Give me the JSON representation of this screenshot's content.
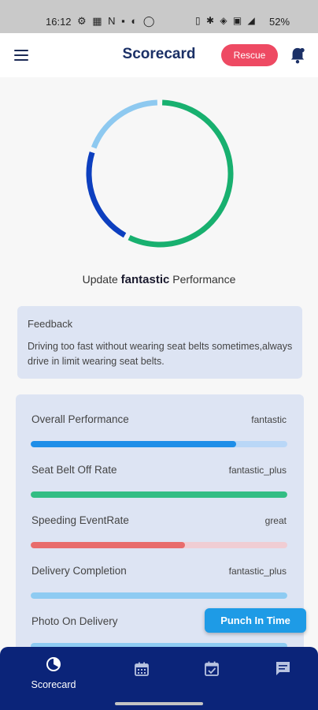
{
  "status_bar": {
    "time": "16:12",
    "left_icons": "⚙ ▦ N ▪ ◐ ◯",
    "right_icons": "▯ ✱ ◈ ▣ ◢",
    "battery": "52%"
  },
  "app_bar": {
    "title": "Scorecard",
    "rescue_label": "Rescue",
    "icons": [
      "hamburger-menu-icon",
      "bell-icon"
    ]
  },
  "donut": {
    "segments": [
      {
        "name": "green",
        "fraction": 0.55,
        "color": "#18b06f"
      },
      {
        "name": "dark-blue",
        "fraction": 0.21,
        "color": "#0d3fbf"
      },
      {
        "name": "light-blue",
        "fraction": 0.18,
        "color": "#8ec9f0"
      }
    ]
  },
  "update": {
    "prefix": "Update",
    "rating": "fantastic",
    "suffix": "Performance"
  },
  "feedback": {
    "title": "Feedback",
    "text": "Driving too fast without wearing seat belts sometimes,always drive in limit wearing seat belts."
  },
  "metrics": [
    {
      "label": "Overall Performance",
      "value": "fantastic",
      "progress": 0.8,
      "fill": "#1e8ee8",
      "track": "#b9d7f7"
    },
    {
      "label": "Seat Belt Off Rate",
      "value": "fantastic_plus",
      "progress": 1.0,
      "fill": "#33bd84",
      "track": "#bfe8d5"
    },
    {
      "label": "Speeding EventRate",
      "value": "great",
      "progress": 0.6,
      "fill": "#e86c6c",
      "track": "#f0cdd3"
    },
    {
      "label": "Delivery Completion",
      "value": "fantastic_plus",
      "progress": 1.0,
      "fill": "#8ecbf2",
      "track": "#cfe7f8"
    },
    {
      "label": "Photo On Delivery",
      "value": "",
      "progress": 1.0,
      "fill": "#8ecbf2",
      "track": "#cfe7f8"
    }
  ],
  "punch_button": "Punch In Time",
  "bottom_nav": {
    "items": [
      {
        "label": "Scorecard",
        "icon": "scorecard-icon"
      },
      {
        "label": "",
        "icon": "calendar-icon"
      },
      {
        "label": "",
        "icon": "calendar-check-icon"
      },
      {
        "label": "",
        "icon": "chat-icon"
      }
    ]
  }
}
